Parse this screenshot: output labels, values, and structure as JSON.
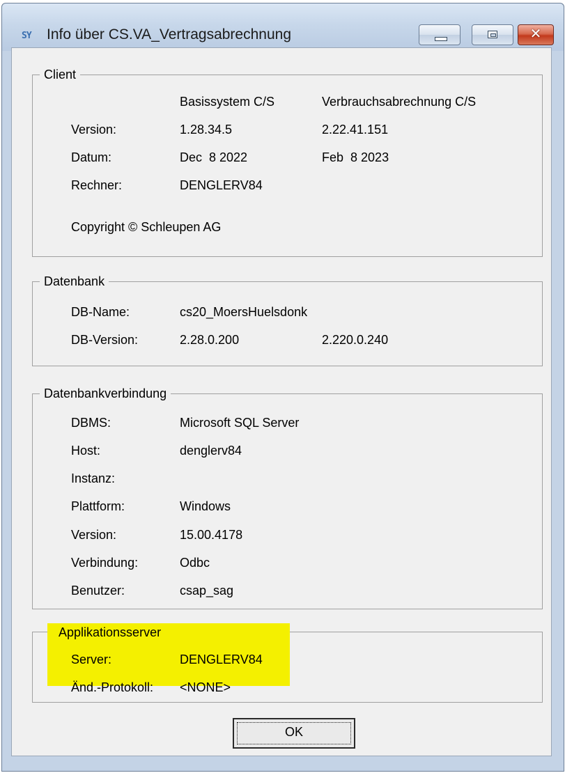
{
  "window": {
    "title": "Info über CS.VA_Vertragsabrechnung",
    "icon_text": "SY"
  },
  "client": {
    "title": "Client",
    "col_headers": [
      "Basissystem C/S",
      "Verbrauchsabrechnung C/S"
    ],
    "version_label": "Version:",
    "version_basis": "1.28.34.5",
    "version_verbrauch": "2.22.41.151",
    "datum_label": "Datum:",
    "datum_basis": "Dec  8 2022",
    "datum_verbrauch": "Feb  8 2023",
    "rechner_label": "Rechner:",
    "rechner_value": "DENGLERV84",
    "copyright": "Copyright © Schleupen AG"
  },
  "datenbank": {
    "title": "Datenbank",
    "dbname_label": "DB-Name:",
    "dbname_value": "cs20_MoersHuelsdonk",
    "dbversion_label": "DB-Version:",
    "dbversion_value1": "2.28.0.200",
    "dbversion_value2": "2.220.0.240"
  },
  "verbindung": {
    "title": "Datenbankverbindung",
    "rows": [
      {
        "label": "DBMS:",
        "value": "Microsoft SQL Server"
      },
      {
        "label": "Host:",
        "value": "denglerv84"
      },
      {
        "label": "Instanz:",
        "value": ""
      },
      {
        "label": "Plattform:",
        "value": "Windows"
      },
      {
        "label": "Version:",
        "value": "15.00.4178"
      },
      {
        "label": "Verbindung:",
        "value": "Odbc"
      },
      {
        "label": "Benutzer:",
        "value": "csap_sag"
      }
    ]
  },
  "appserver": {
    "title": "Applikationsserver",
    "server_label": "Server:",
    "server_value": "DENGLERV84",
    "protokoll_label": "Änd.-Protokoll:",
    "protokoll_value": "<NONE>"
  },
  "buttons": {
    "ok_label": "OK"
  },
  "colors": {
    "highlight": "#f4f000",
    "dialog_bg": "#f0f0f0",
    "frame": "#c4d3e6"
  }
}
